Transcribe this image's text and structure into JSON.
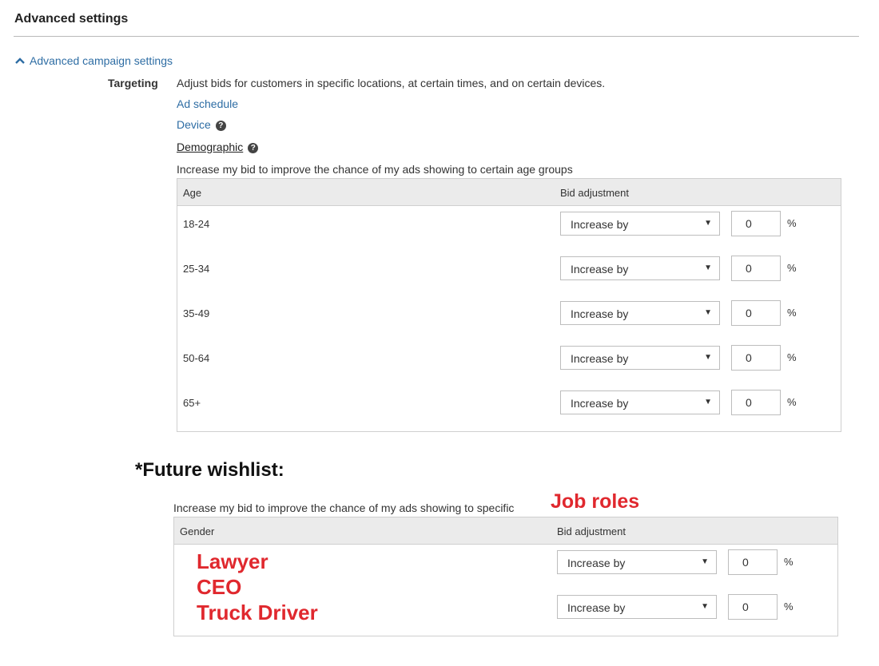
{
  "section": {
    "title": "Advanced settings",
    "toggle_label": "Advanced campaign settings"
  },
  "targeting": {
    "label": "Targeting",
    "description": "Adjust bids for customers in specific locations, at certain times, and on certain devices.",
    "links": {
      "ad_schedule": "Ad schedule",
      "device": "Device",
      "demographic": "Demographic"
    },
    "help_glyph": "?"
  },
  "age_table": {
    "intro": "Increase my bid to improve the chance of my ads showing to certain age groups",
    "col_age": "Age",
    "col_bid": "Bid adjustment",
    "rows": [
      {
        "label": "18-24",
        "mode": "Increase by",
        "value": "0",
        "unit": "%"
      },
      {
        "label": "25-34",
        "mode": "Increase by",
        "value": "0",
        "unit": "%"
      },
      {
        "label": "35-49",
        "mode": "Increase by",
        "value": "0",
        "unit": "%"
      },
      {
        "label": "50-64",
        "mode": "Increase by",
        "value": "0",
        "unit": "%"
      },
      {
        "label": "65+",
        "mode": "Increase by",
        "value": "0",
        "unit": "%"
      }
    ]
  },
  "wishlist": {
    "title": "*Future wishlist:",
    "intro": "Increase my bid to improve the chance of my ads showing to specific",
    "highlight": "Job roles",
    "col_gender": "Gender",
    "col_bid": "Bid adjustment",
    "roles": [
      "Lawyer",
      "CEO",
      "Truck Driver"
    ],
    "rows": [
      {
        "mode": "Increase by",
        "value": "0",
        "unit": "%"
      },
      {
        "mode": "Increase by",
        "value": "0",
        "unit": "%"
      }
    ]
  },
  "colors": {
    "link": "#2e6da4",
    "highlight_red": "#e0282e",
    "table_header_bg": "#ebebeb"
  },
  "icons": {
    "toggle": "chevron-up-icon",
    "help": "question-circle-icon",
    "dropdown": "caret-down-icon"
  }
}
